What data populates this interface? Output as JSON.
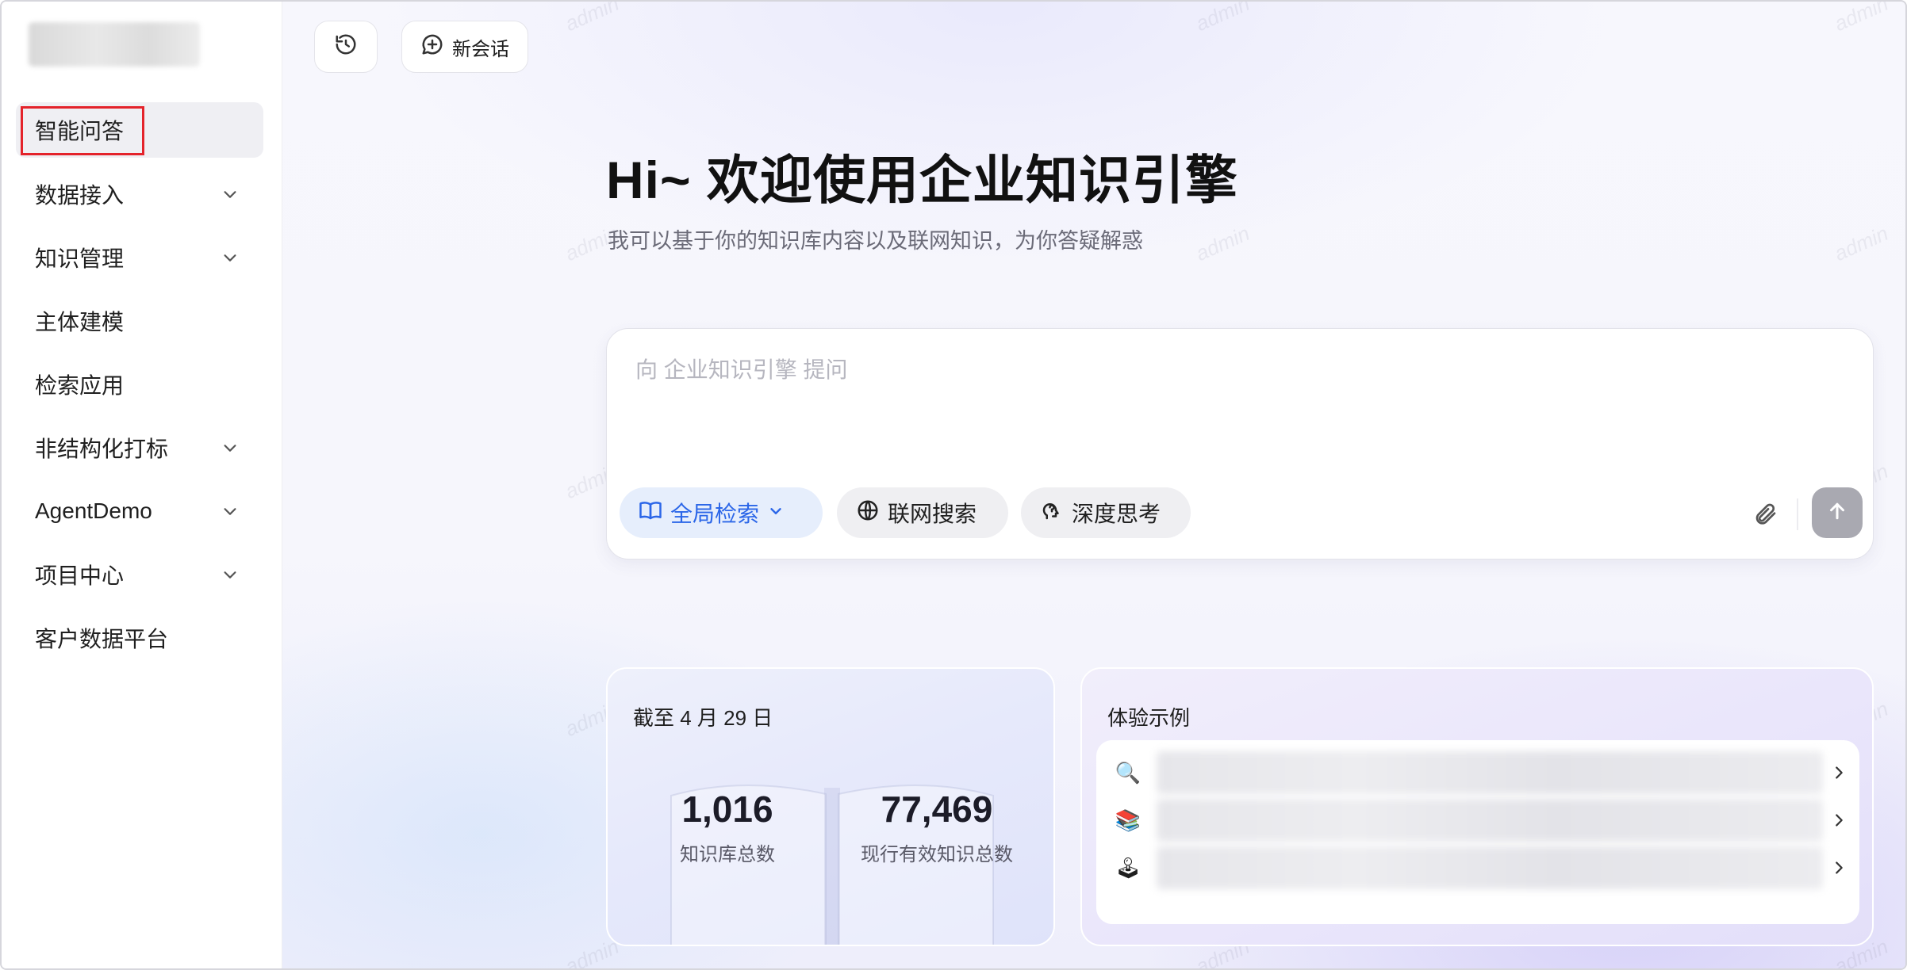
{
  "sidebar": {
    "logo_icon": "blurred-logo",
    "items": [
      {
        "label": "智能问答",
        "expandable": false,
        "active": true
      },
      {
        "label": "数据接入",
        "expandable": true
      },
      {
        "label": "知识管理",
        "expandable": true
      },
      {
        "label": "主体建模",
        "expandable": false
      },
      {
        "label": "检索应用",
        "expandable": false
      },
      {
        "label": "非结构化打标",
        "expandable": true
      },
      {
        "label": "AgentDemo",
        "expandable": true
      },
      {
        "label": "项目中心",
        "expandable": true
      },
      {
        "label": "客户数据平台",
        "expandable": false
      }
    ]
  },
  "header": {
    "history_icon": "history-icon",
    "new_chat_label": "新会话",
    "new_chat_icon": "chat-plus-icon"
  },
  "hero": {
    "title": "Hi~ 欢迎使用企业知识引擎",
    "subtitle": "我可以基于你的知识库内容以及联网知识，为你答疑解惑"
  },
  "composer": {
    "placeholder": "向 企业知识引擎 提问",
    "global_search_label": "全局检索",
    "web_search_label": "联网搜索",
    "deep_think_label": "深度思考",
    "attach_icon": "paperclip-icon",
    "send_icon": "arrow-up-icon"
  },
  "stats": {
    "date_label": "截至 4 月 29 日",
    "kb_total": "1,016",
    "kb_total_label": "知识库总数",
    "knowledge_total": "77,469",
    "knowledge_total_label": "现行有效知识总数"
  },
  "examples": {
    "title": "体验示例",
    "rows": [
      {
        "icon": "🔍",
        "icon_name": "magnifier-icon"
      },
      {
        "icon": "📚",
        "icon_name": "books-icon"
      },
      {
        "icon": "🕹",
        "icon_name": "joystick-icon"
      }
    ]
  },
  "watermark": "admin",
  "colors": {
    "accent_blue": "#2b66e8",
    "highlight_red": "#e4232b",
    "send_disabled": "#a9a9b1"
  }
}
